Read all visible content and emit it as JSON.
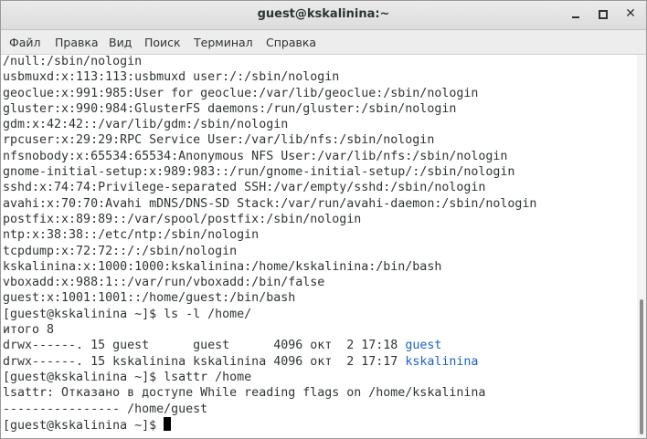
{
  "window": {
    "title": "guest@kskalinina:~",
    "buttons": {
      "minimize": "minimize-icon",
      "maximize": "maximize-icon",
      "close": "close-icon",
      "close_glyph": "✕"
    }
  },
  "menubar": {
    "items": [
      {
        "label": "Файл"
      },
      {
        "label": "Правка"
      },
      {
        "label": "Вид"
      },
      {
        "label": "Поиск"
      },
      {
        "label": "Терминал"
      },
      {
        "label": "Справка"
      }
    ]
  },
  "colors": {
    "directory": "#1c62c5",
    "text": "#2e3436"
  },
  "terminal": {
    "prompt": "[guest@kskalinina ~]$ ",
    "lines": [
      {
        "text": "/null:/sbin/nologin"
      },
      {
        "text": "usbmuxd:x:113:113:usbmuxd user:/:/sbin/nologin"
      },
      {
        "text": "geoclue:x:991:985:User for geoclue:/var/lib/geoclue:/sbin/nologin"
      },
      {
        "text": "gluster:x:990:984:GlusterFS daemons:/run/gluster:/sbin/nologin"
      },
      {
        "text": "gdm:x:42:42::/var/lib/gdm:/sbin/nologin"
      },
      {
        "text": "rpcuser:x:29:29:RPC Service User:/var/lib/nfs:/sbin/nologin"
      },
      {
        "text": "nfsnobody:x:65534:65534:Anonymous NFS User:/var/lib/nfs:/sbin/nologin"
      },
      {
        "text": "gnome-initial-setup:x:989:983::/run/gnome-initial-setup/:/sbin/nologin"
      },
      {
        "text": "sshd:x:74:74:Privilege-separated SSH:/var/empty/sshd:/sbin/nologin"
      },
      {
        "text": "avahi:x:70:70:Avahi mDNS/DNS-SD Stack:/var/run/avahi-daemon:/sbin/nologin"
      },
      {
        "text": "postfix:x:89:89::/var/spool/postfix:/sbin/nologin"
      },
      {
        "text": "ntp:x:38:38::/etc/ntp:/sbin/nologin"
      },
      {
        "text": "tcpdump:x:72:72::/:/sbin/nologin"
      },
      {
        "text": "kskalinina:x:1000:1000:kskalinina:/home/kskalinina:/bin/bash"
      },
      {
        "text": "vboxadd:x:988:1::/var/run/vboxadd:/bin/false"
      },
      {
        "text": "guest:x:1001:1001::/home/guest:/bin/bash"
      },
      {
        "text": "[guest@kskalinina ~]$ ls -l /home/"
      },
      {
        "text": "итого 8"
      },
      {
        "text": "drwx------. 15 guest      guest      4096 окт  2 17:18 ",
        "dir": "guest"
      },
      {
        "text": "drwx------. 15 kskalinina kskalinina 4096 окт  2 17:17 ",
        "dir": "kskalinina"
      },
      {
        "text": "[guest@kskalinina ~]$ lsattr /home"
      },
      {
        "text": "lsattr: Отказано в доступе While reading flags on /home/kskalinina"
      },
      {
        "text": "---------------- /home/guest"
      }
    ]
  }
}
